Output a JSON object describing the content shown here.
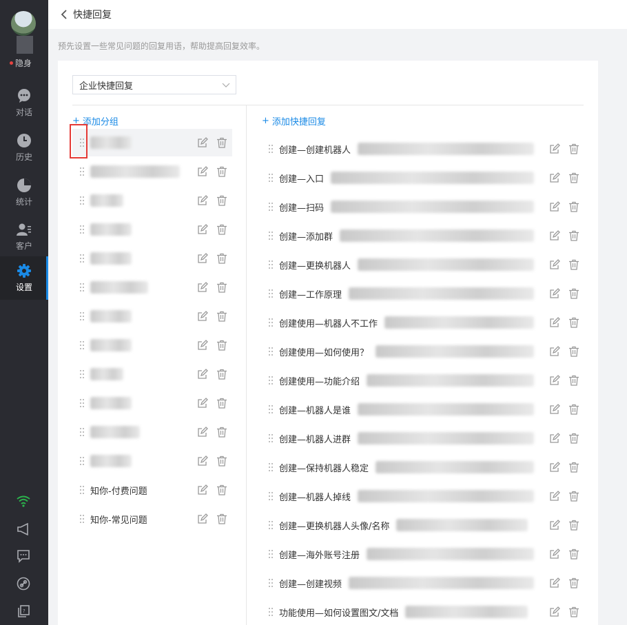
{
  "sidebar": {
    "status_label": "隐身",
    "nav": [
      {
        "label": "对话",
        "icon": "chat-icon"
      },
      {
        "label": "历史",
        "icon": "clock-icon"
      },
      {
        "label": "统计",
        "icon": "pie-chart-icon"
      },
      {
        "label": "客户",
        "icon": "contacts-icon"
      },
      {
        "label": "设置",
        "icon": "gear-icon",
        "active": true
      }
    ],
    "bottom_icons": [
      "wifi-icon",
      "megaphone-icon",
      "feedback-icon",
      "link-icon",
      "copy-icon"
    ]
  },
  "header": {
    "title": "快捷回复"
  },
  "subtitle": "预先设置一些常见问题的回复用语，帮助提高回复效率。",
  "select": {
    "value": "企业快捷回复"
  },
  "add_group_label": "添加分组",
  "add_reply_label": "添加快捷回复",
  "groups": [
    {
      "name": "",
      "selected": true
    },
    {
      "name": ""
    },
    {
      "name": ""
    },
    {
      "name": ""
    },
    {
      "name": ""
    },
    {
      "name": ""
    },
    {
      "name": ""
    },
    {
      "name": ""
    },
    {
      "name": ""
    },
    {
      "name": ""
    },
    {
      "name": ""
    },
    {
      "name": ""
    },
    {
      "name": "知你-付费问题"
    },
    {
      "name": "知你-常见问题"
    }
  ],
  "replies": [
    "创建—创建机器人",
    "创建—入口",
    "创建—扫码",
    "创建—添加群",
    "创建—更换机器人",
    "创建—工作原理",
    "创建使用—机器人不工作",
    "创建使用—如何使用？",
    "创建使用—功能介绍",
    "创建—机器人是谁",
    "创建—机器人进群",
    "创建—保持机器人稳定",
    "创建—机器人掉线",
    "创建—更换机器人头像/名称",
    "创建—海外账号注册",
    "创建—创建视频",
    "功能使用—如何设置图文/文档"
  ],
  "colors": {
    "sidebar_bg": "#2a2b31",
    "accent": "#1a8ae6",
    "highlight": "#e53935",
    "status_dot": "#e64340"
  }
}
